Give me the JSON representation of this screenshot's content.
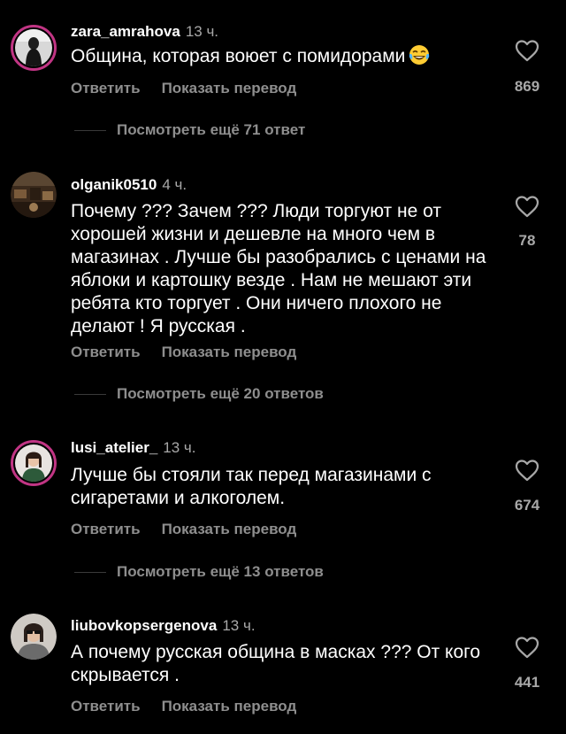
{
  "comments": [
    {
      "username": "zara_amrahova",
      "time": "13 ч.",
      "text": "Община, которая воюет с помидорами",
      "emoji_icon": "laughing-tears-emoji-icon",
      "reply_label": "Ответить",
      "translate_label": "Показать перевод",
      "likes": "869",
      "more_replies": "Посмотреть ещё 71 ответ",
      "has_story_ring": true
    },
    {
      "username": "olganik0510",
      "time": "4 ч.",
      "text": "Почему ??? Зачем ??? Люди торгуют не от хорошей жизни и дешевле на много чем в магазинах . Лучше бы разобрались с ценами на яблоки и картошку везде . Нам не мешают эти ребята кто торгует . Они ничего плохого не делают ! Я русская .",
      "reply_label": "Ответить",
      "translate_label": "Показать перевод",
      "likes": "78",
      "more_replies": "Посмотреть ещё 20 ответов",
      "has_story_ring": false
    },
    {
      "username": "lusi_atelier_",
      "time": "13 ч.",
      "text": "Лучше бы стояли так перед магазинами с сигаретами и алкоголем.",
      "reply_label": "Ответить",
      "translate_label": "Показать перевод",
      "likes": "674",
      "more_replies": "Посмотреть ещё 13 ответов",
      "has_story_ring": true
    },
    {
      "username": "liubovkopsergenova",
      "time": "13 ч.",
      "text": "А почему русская община в масках ??? От кого скрывается .",
      "reply_label": "Ответить",
      "translate_label": "Показать перевод",
      "likes": "441",
      "has_story_ring": false
    }
  ],
  "colors": {
    "background": "#000000",
    "text": "#ffffff",
    "secondary": "#8e8e8e",
    "story_ring": "#c13584"
  },
  "icons": {
    "like": "heart-outline-icon",
    "avatar": "user-avatar"
  }
}
